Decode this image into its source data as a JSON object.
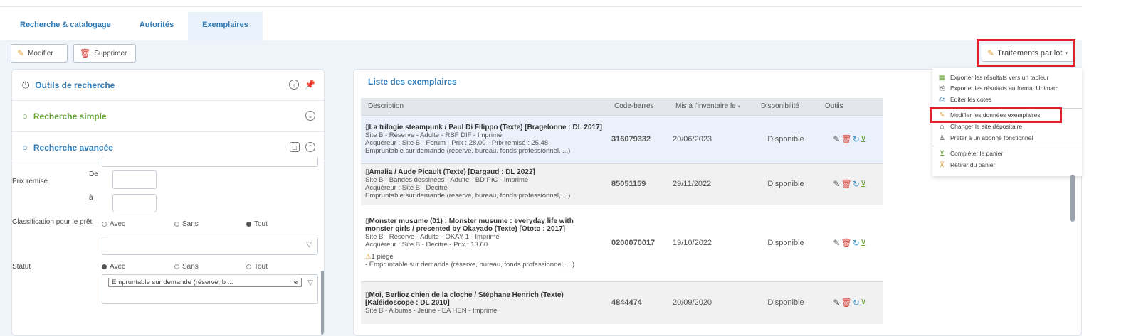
{
  "tabs": [
    {
      "label": "Recherche & catalogage"
    },
    {
      "label": "Autorités"
    },
    {
      "label": "Exemplaires"
    }
  ],
  "toolbar": {
    "modify_label": "Modifier",
    "delete_label": "Supprimer"
  },
  "left_panel": {
    "tools_title": "Outils de recherche",
    "simple_title": "Recherche simple",
    "advanced_title": "Recherche avancée",
    "fields": {
      "prix_remise_label": "Prix remisé",
      "de_label": "De",
      "a_label": "à",
      "classification_label": "Classification pour le prêt",
      "statut_label": "Statut",
      "opt_avec": "Avec",
      "opt_sans": "Sans",
      "opt_tout": "Tout",
      "statut_tag": "Empruntable sur demande (réserve, b ..."
    }
  },
  "list": {
    "title": "Liste des exemplaires",
    "columns": [
      "Description",
      "Code-barres",
      "Mis à l'inventaire le",
      "Disponibilité",
      "Outils"
    ],
    "rows": [
      {
        "title": "La trilogie steampunk / Paul Di Filippo (Texte) [Bragelonne : DL 2017]",
        "line1": "Site B - Réserve - Adulte - RSF DIF - Imprimé",
        "line2": "Acquéreur : Site B - Forum - Prix : 28.00 - Prix remisé : 25.48",
        "line3": "Empruntable sur demande (réserve, bureau, fonds professionnel, ...)",
        "barcode": "316079332",
        "date": "20/06/2023",
        "availability": "Disponible"
      },
      {
        "title": "Amalia / Aude Picault (Texte) [Dargaud : DL 2022]",
        "line1": "Site B - Bandes dessinées - Adulte - BD PIC - Imprimé",
        "line2": "Acquéreur : Site B - Decitre",
        "line3": "Empruntable sur demande (réserve, bureau, fonds professionnel, ...)",
        "barcode": "85051159",
        "date": "29/11/2022",
        "availability": "Disponible"
      },
      {
        "title": "Monster musume (01) : Monster musume : everyday life with monster girls / presented by Okayado (Texte) [Ototo : 2017]",
        "line1": "Site B - Réserve - Adulte - OKAY 1 - Imprimé",
        "line2": "Acquéreur : Site B - Decitre - Prix : 13.60",
        "warning": "1 piège",
        "line3": "- Empruntable sur demande (réserve, bureau, fonds professionnel, ...)",
        "barcode": "0200070017",
        "date": "19/10/2022",
        "availability": "Disponible"
      },
      {
        "title": "Moi, Berlioz chien de la cloche / Stéphane Henrich (Texte) [Kaléidoscope : DL 2010]",
        "line1": "Site B - Albums - Jeune - EA HEN - Imprimé",
        "barcode": "4844474",
        "date": "20/09/2020",
        "availability": "Disponible"
      }
    ]
  },
  "batch": {
    "button_label": "Traitements par lot",
    "menu": [
      "Exporter les résultats vers un tableur",
      "Exporter les résultats au format Unimarc",
      "Editer les cotes",
      "Modifier les données exemplaires",
      "Changer le site dépositaire",
      "Prêter à un abonné fonctionnel",
      "Compléter le panier",
      "Retirer du panier"
    ]
  },
  "colors": {
    "accent": "#2e79b5",
    "green": "#67a233",
    "highlight_red": "#e0202a"
  }
}
